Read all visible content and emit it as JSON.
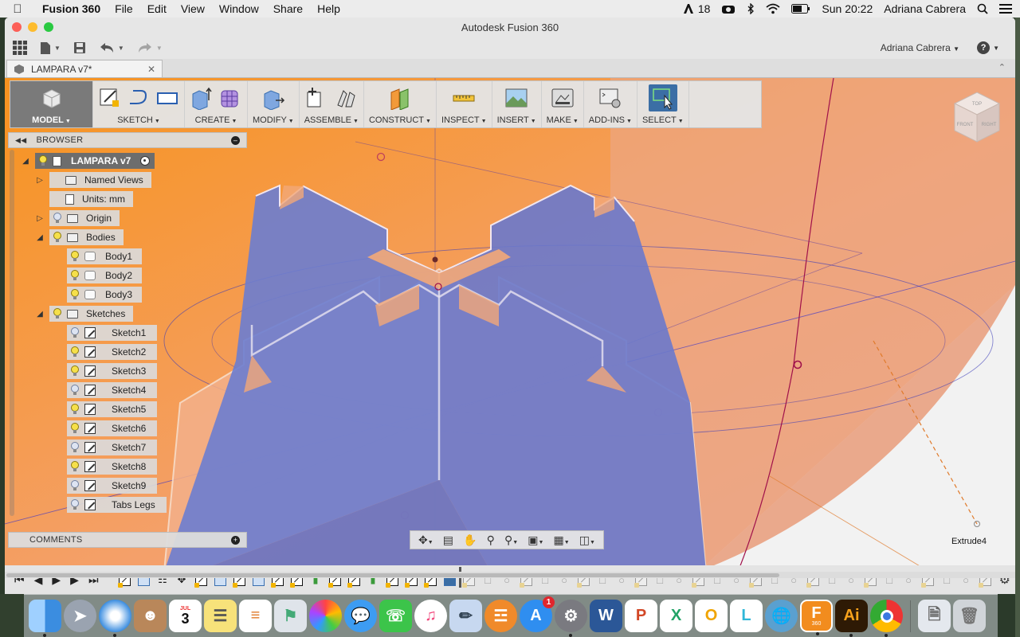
{
  "menubar": {
    "app_name": "Fusion 360",
    "items": [
      "File",
      "Edit",
      "View",
      "Window",
      "Share",
      "Help"
    ],
    "status": {
      "adobe_count": "18",
      "clock": "Sun 20:22",
      "user": "Adriana Cabrera"
    }
  },
  "window": {
    "title": "Autodesk Fusion 360",
    "user_menu": "Adriana Cabrera",
    "help": "?"
  },
  "document_tab": {
    "label": "LAMPARA v7*"
  },
  "ribbon": {
    "groups": [
      "MODEL",
      "SKETCH",
      "CREATE",
      "MODIFY",
      "ASSEMBLE",
      "CONSTRUCT",
      "INSPECT",
      "INSERT",
      "MAKE",
      "ADD-INS",
      "SELECT"
    ]
  },
  "viewcube": {
    "faces": [
      "TOP",
      "FRONT",
      "RIGHT"
    ]
  },
  "browser": {
    "title": "BROWSER",
    "root": "LAMPARA v7",
    "named_views": "Named Views",
    "units": "Units: mm",
    "origin": "Origin",
    "bodies_label": "Bodies",
    "bodies": [
      "Body1",
      "Body2",
      "Body3"
    ],
    "sketches_label": "Sketches",
    "sketches": [
      "Sketch1",
      "Sketch2",
      "Sketch3",
      "Sketch4",
      "Sketch5",
      "Sketch6",
      "Sketch7",
      "Sketch8",
      "Sketch9",
      "Tabs  Legs"
    ]
  },
  "comments": {
    "title": "COMMENTS"
  },
  "feature_label": "Extrude4",
  "dock": {
    "calendar_month": "JUL",
    "calendar_day": "3",
    "appstore_badge": "1",
    "fusion_sub": "360",
    "colors": {
      "word": "#2b5797",
      "illustrator": "#2e1a05",
      "fusion": "#f28c1e"
    }
  },
  "colors": {
    "canvas_orange": "#f6a35c",
    "panel_blue": "#6f7fcf",
    "select_blue": "#3b6ea5"
  }
}
